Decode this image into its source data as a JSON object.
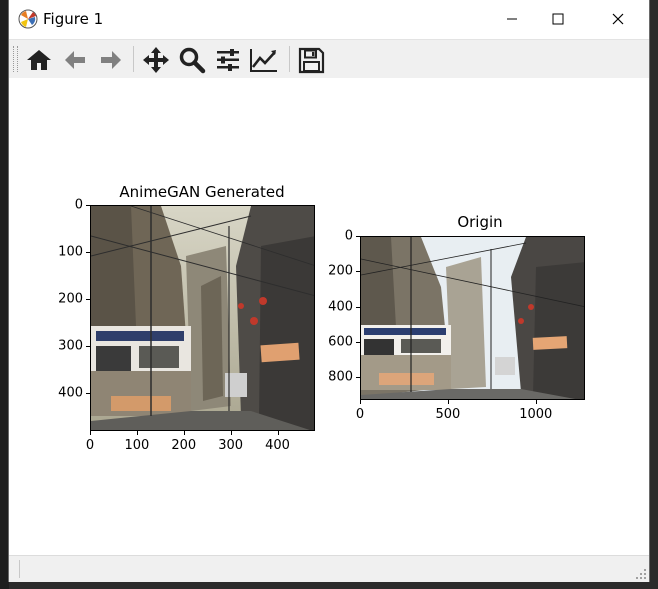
{
  "window": {
    "title": "Figure 1"
  },
  "toolbar": {
    "buttons": [
      {
        "name": "home-icon",
        "tooltip": "Reset original view"
      },
      {
        "name": "back-arrow-icon",
        "tooltip": "Back to previous view"
      },
      {
        "name": "forward-arrow-icon",
        "tooltip": "Forward to next view"
      },
      {
        "name": "pan-move-icon",
        "tooltip": "Pan axes"
      },
      {
        "name": "zoom-magnifier-icon",
        "tooltip": "Zoom to rectangle"
      },
      {
        "name": "configure-subplots-icon",
        "tooltip": "Configure subplots"
      },
      {
        "name": "edit-axis-icon",
        "tooltip": "Edit axis, curve and image parameters"
      },
      {
        "name": "save-floppy-icon",
        "tooltip": "Save the figure"
      }
    ]
  },
  "status": {
    "message": ""
  },
  "colors": {
    "titlebar_bg": "#ffffff",
    "toolbar_bg": "#f0f0f0",
    "canvas_bg": "#ffffff",
    "icon": "#222222"
  },
  "plots": [
    {
      "title": "AnimeGAN Generated",
      "image_description": "anime-styled narrow street scene",
      "xlim": [
        0,
        480
      ],
      "ylim": [
        480,
        0
      ],
      "xticks": [
        "0",
        "100",
        "200",
        "300",
        "400"
      ],
      "xtick_values": [
        0,
        100,
        200,
        300,
        400
      ],
      "yticks": [
        "0",
        "100",
        "200",
        "300",
        "400"
      ],
      "ytick_values": [
        0,
        100,
        200,
        300,
        400
      ]
    },
    {
      "title": "Origin",
      "image_description": "original photo of narrow street scene",
      "xlim": [
        0,
        1280
      ],
      "ylim": [
        930,
        0
      ],
      "xticks": [
        "0",
        "500",
        "1000"
      ],
      "xtick_values": [
        0,
        500,
        1000
      ],
      "yticks": [
        "0",
        "200",
        "400",
        "600",
        "800"
      ],
      "ytick_values": [
        0,
        200,
        400,
        600,
        800
      ]
    }
  ]
}
